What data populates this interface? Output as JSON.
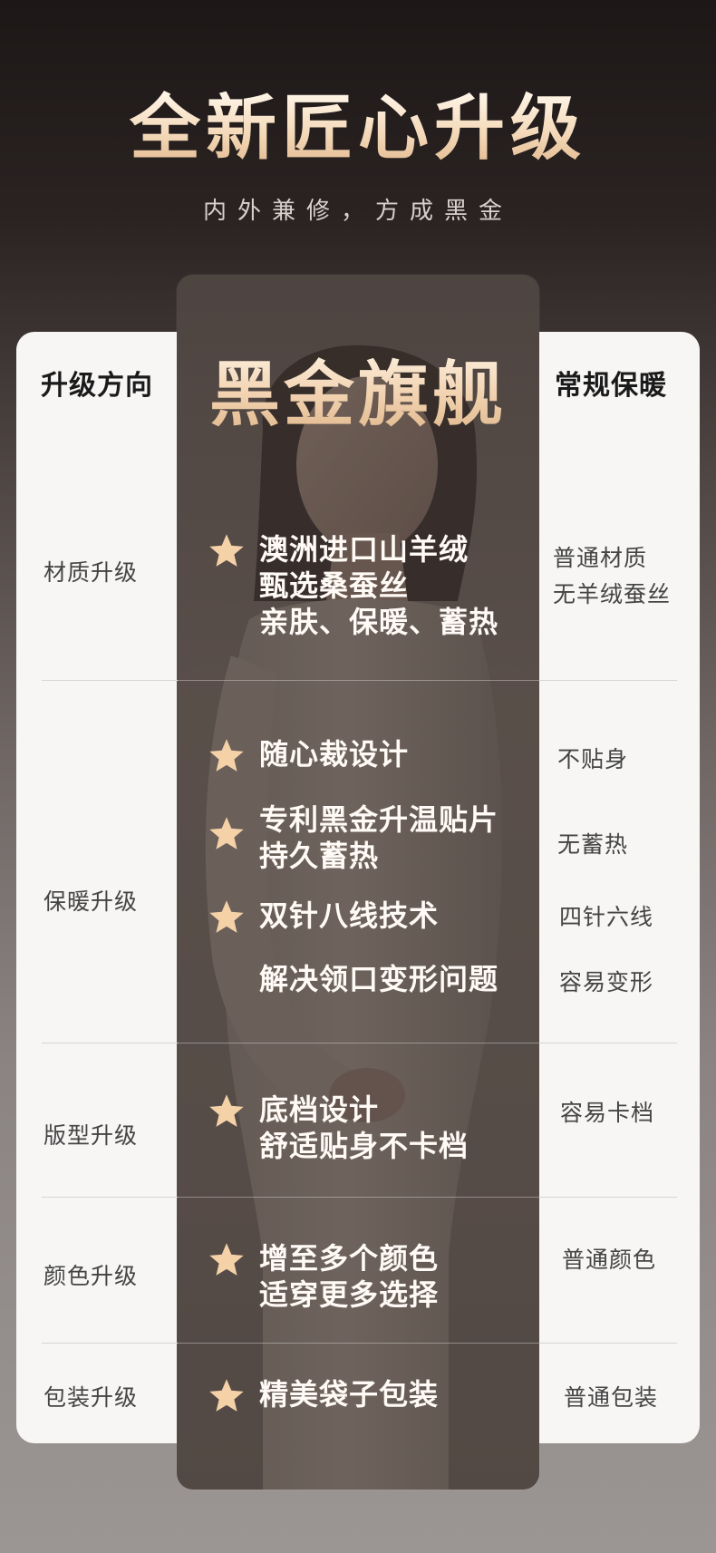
{
  "header": {
    "title": "全新匠心升级",
    "subtitle": "内外兼修，方成黑金"
  },
  "table": {
    "left_header": "升级方向",
    "center_header": "黑金旗舰",
    "right_header": "常规保暖",
    "rows": [
      {
        "label": "材质升级",
        "center": [
          {
            "star": true,
            "lines": [
              "澳洲进口山羊绒",
              "甄选桑蚕丝",
              "亲肤、保暖、蓄热"
            ]
          }
        ],
        "right": [
          "普通材质",
          "无羊绒蚕丝"
        ]
      },
      {
        "label": "保暖升级",
        "center": [
          {
            "star": true,
            "lines": [
              "随心裁设计"
            ]
          },
          {
            "star": true,
            "lines": [
              "专利黑金升温贴片",
              "持久蓄热"
            ]
          },
          {
            "star": true,
            "lines": [
              "双针八线技术"
            ]
          },
          {
            "star": false,
            "lines": [
              "解决领口变形问题"
            ]
          }
        ],
        "right": [
          "不贴身",
          "无蓄热",
          "四针六线",
          "容易变形"
        ]
      },
      {
        "label": "版型升级",
        "center": [
          {
            "star": true,
            "lines": [
              "底档设计",
              "舒适贴身不卡档"
            ]
          }
        ],
        "right": [
          "容易卡档"
        ]
      },
      {
        "label": "颜色升级",
        "center": [
          {
            "star": true,
            "lines": [
              "增至多个颜色",
              "适穿更多选择"
            ]
          }
        ],
        "right": [
          "普通颜色"
        ]
      },
      {
        "label": "包装升级",
        "center": [
          {
            "star": true,
            "lines": [
              "精美袋子包装"
            ]
          }
        ],
        "right": [
          "普通包装"
        ]
      }
    ]
  },
  "colors": {
    "gold": "#f3d7b8",
    "star": "#f5d1a8",
    "panel": "#5f5650"
  },
  "icons": [
    "star-icon"
  ]
}
